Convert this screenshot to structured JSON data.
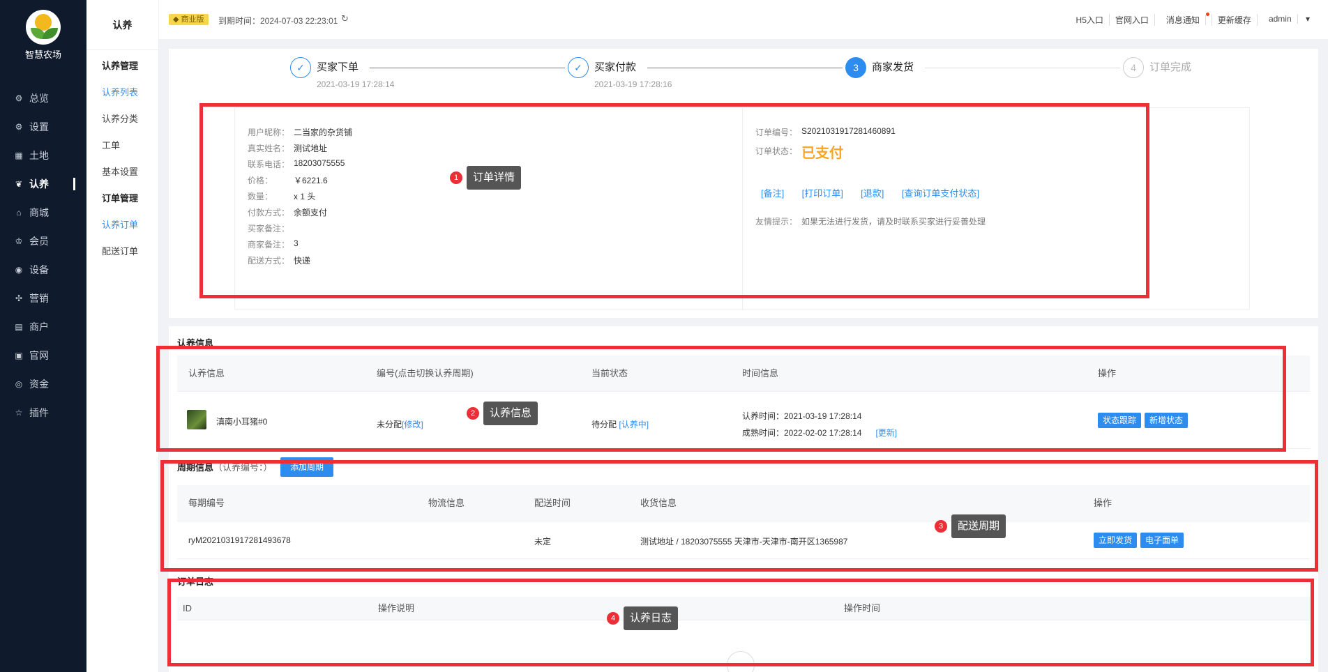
{
  "app": {
    "logo_name": "智慧农场"
  },
  "sidebar": {
    "items": [
      {
        "label": "总览",
        "icon": "dashboard-icon",
        "glyph": "⚙"
      },
      {
        "label": "设置",
        "icon": "gear-icon",
        "glyph": "⚙"
      },
      {
        "label": "土地",
        "icon": "grid-icon",
        "glyph": "▦"
      },
      {
        "label": "认养",
        "icon": "adopt-icon",
        "glyph": "❦"
      },
      {
        "label": "商城",
        "icon": "shop-icon",
        "glyph": "⌂"
      },
      {
        "label": "会员",
        "icon": "member-icon",
        "glyph": "♔"
      },
      {
        "label": "设备",
        "icon": "device-icon",
        "glyph": "◉"
      },
      {
        "label": "营销",
        "icon": "marketing-icon",
        "glyph": "✣"
      },
      {
        "label": "商户",
        "icon": "merchant-icon",
        "glyph": "▤"
      },
      {
        "label": "官网",
        "icon": "website-icon",
        "glyph": "▣"
      },
      {
        "label": "资金",
        "icon": "fund-icon",
        "glyph": "◎"
      },
      {
        "label": "插件",
        "icon": "plugin-icon",
        "glyph": "☆"
      }
    ],
    "active_index": 3
  },
  "submenu": {
    "title": "认养",
    "items": [
      {
        "label": "认养管理",
        "type": "group"
      },
      {
        "label": "认养列表",
        "type": "selected"
      },
      {
        "label": "认养分类",
        "type": "item"
      },
      {
        "label": "工单",
        "type": "item"
      },
      {
        "label": "基本设置",
        "type": "item"
      },
      {
        "label": "订单管理",
        "type": "group"
      },
      {
        "label": "认养订单",
        "type": "selected"
      },
      {
        "label": "配送订单",
        "type": "item"
      }
    ]
  },
  "topbar": {
    "edition": "商业版",
    "expire": "到期时间：2024-07-03 22:23:01",
    "links": [
      "H5入口",
      "官网入口",
      "消息通知",
      "更新缓存",
      "admin"
    ]
  },
  "steps": [
    {
      "name": "买家下单",
      "time": "2021-03-19 17:28:14",
      "state": "done"
    },
    {
      "name": "买家付款",
      "time": "2021-03-19 17:28:16",
      "state": "done"
    },
    {
      "name": "商家发货",
      "time": "",
      "state": "current",
      "num": "3"
    },
    {
      "name": "订单完成",
      "time": "",
      "state": "wait",
      "num": "4"
    }
  ],
  "order_detail": {
    "left": [
      {
        "label": "用户昵称：",
        "value": "二当家的杂货铺"
      },
      {
        "label": "真实姓名：",
        "value": "测试地址"
      },
      {
        "label": "联系电话：",
        "value": "18203075555"
      },
      {
        "label": "价格：",
        "value": "￥6221.6"
      },
      {
        "label": "数量：",
        "value": "x 1 头"
      },
      {
        "label": "付款方式：",
        "value": "余额支付"
      },
      {
        "label": "买家备注：",
        "value": ""
      },
      {
        "label": "商家备注：",
        "value": "3"
      },
      {
        "label": "配送方式：",
        "value": "快递"
      }
    ],
    "order_no_label": "订单编号：",
    "order_no": "S2021031917281460891",
    "status_label": "订单状态：",
    "status": "已支付",
    "actions": [
      "[备注]",
      "[打印订单]",
      "[退款]",
      "[查询订单支付状态]"
    ],
    "tip_label": "友情提示：",
    "tip": "如果无法进行发货，请及时联系买家进行妥善处理"
  },
  "adopt_info": {
    "title": "认养信息",
    "headers": [
      "认养信息",
      "编号(点击切换认养周期)",
      "当前状态",
      "时间信息",
      "操作"
    ],
    "row": {
      "name": "滇南小耳猪#0",
      "code": "未分配",
      "code_link": "[修改]",
      "status": "待分配",
      "status_link": "[认养中]",
      "adopt_time": "认养时间：2021-03-19 17:28:14",
      "mature_time": "成熟时间：2022-02-02 17:28:14",
      "update_link": "[更新]",
      "buttons": [
        "状态跟踪",
        "新增状态"
      ]
    }
  },
  "period_info": {
    "title": "周期信息",
    "sub": "（认养编号：）",
    "add_button": "添加周期",
    "headers": [
      "每期编号",
      "物流信息",
      "配送时间",
      "收货信息",
      "操作"
    ],
    "row": {
      "no": "ryM2021031917281493678",
      "logistics": "",
      "time": "未定",
      "receiver": "测试地址 / 18203075555 天津市-天津市-南开区1365987",
      "buttons": [
        "立即发货",
        "电子面单"
      ]
    }
  },
  "order_log": {
    "title": "订单日志",
    "headers": [
      "ID",
      "操作说明",
      "操作时间"
    ]
  },
  "annotations": [
    {
      "num": "1",
      "text": "订单详情"
    },
    {
      "num": "2",
      "text": "认养信息"
    },
    {
      "num": "3",
      "text": "配送周期"
    },
    {
      "num": "4",
      "text": "认养日志"
    }
  ],
  "colors": {
    "primary": "#2d8cf0",
    "sidebar": "#0f1b2d",
    "annotation_red": "#ec2f36",
    "paid_orange": "#f5a623"
  }
}
